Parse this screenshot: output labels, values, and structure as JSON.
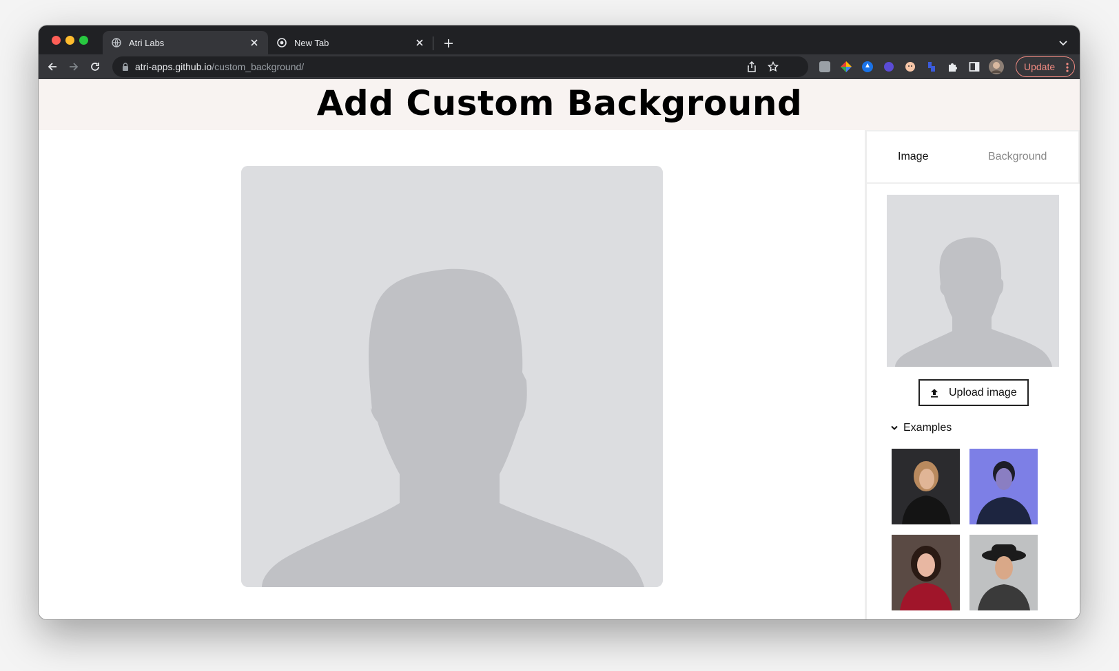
{
  "browser": {
    "tabs": [
      {
        "title": "Atri Labs",
        "active": true
      },
      {
        "title": "New Tab",
        "active": false
      }
    ],
    "url_domain": "atri-apps.github.io",
    "url_path": "/custom_background/",
    "update_label": "Update"
  },
  "page": {
    "title": "Add Custom Background"
  },
  "panel": {
    "tabs": [
      {
        "label": "Image",
        "selected": true
      },
      {
        "label": "Background",
        "selected": false
      }
    ],
    "upload_label": "Upload image",
    "examples_label": "Examples",
    "examples": [
      {
        "name": "example-portrait-1"
      },
      {
        "name": "example-portrait-2"
      },
      {
        "name": "example-portrait-3"
      },
      {
        "name": "example-portrait-4"
      }
    ]
  },
  "colors": {
    "chrome_dark": "#202124",
    "chrome_toolbar": "#35363a",
    "header_band": "#f8f3f1",
    "placeholder_bg": "#dcdde0",
    "silhouette": "#c0c1c5",
    "update_accent": "#f28b82"
  }
}
